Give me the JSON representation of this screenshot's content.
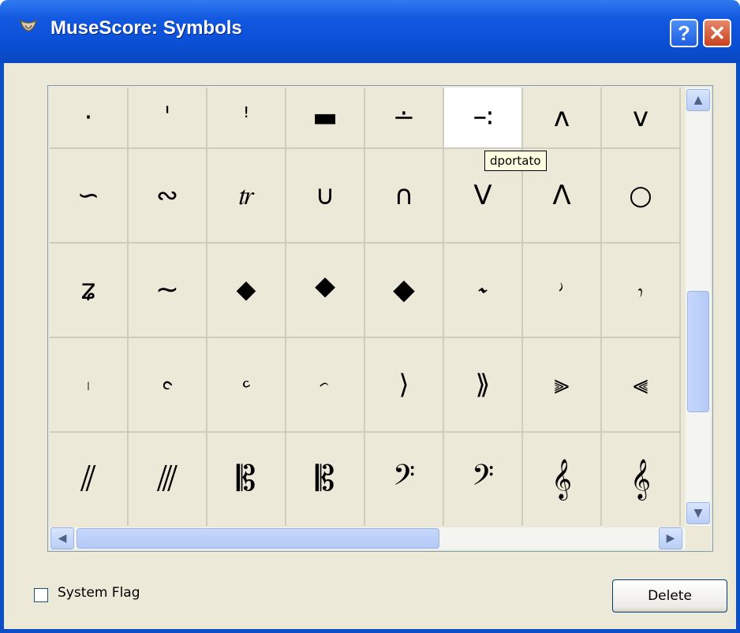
{
  "window": {
    "title": "MuseScore: Symbols",
    "help_label": "?",
    "close_label": "✕"
  },
  "tooltip": "dportato",
  "symbols": [
    [
      "·",
      "ˈ",
      "ꜝ",
      "▬",
      "∸",
      "∹",
      "ʌ",
      "v"
    ],
    [
      "∽",
      "∾",
      "𝆖",
      "∪",
      "∩",
      "V",
      "Λ",
      "○"
    ],
    [
      "ʑ",
      "∼",
      "⬥",
      "⯁",
      "◆",
      "𝆝",
      "𝆞",
      "𝆟"
    ],
    [
      "𝆠",
      "𝆡",
      "𝆢",
      "𝆣",
      "⟩",
      "⟫",
      "⫸",
      "⫷"
    ],
    [
      "⫽",
      "⫻",
      "𝄡",
      "𝄡",
      "𝄢",
      "𝄢",
      "𝄞",
      "𝄞"
    ]
  ],
  "selected": {
    "row": 0,
    "col": 5
  },
  "scroll": {
    "up": "▲",
    "down": "▼",
    "left": "◀",
    "right": "▶"
  },
  "system_flag": {
    "label": "System Flag",
    "checked": false
  },
  "delete_label": "Delete"
}
